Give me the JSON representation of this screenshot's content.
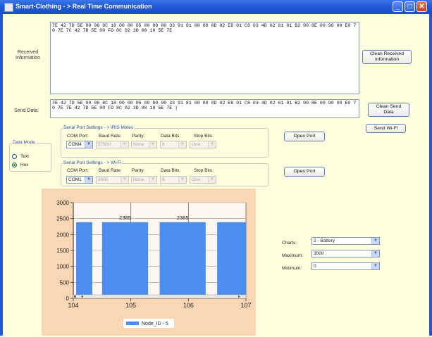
{
  "window": {
    "title": "Smart-Clothing - > Real Time Communication",
    "min_glyph": "_",
    "max_glyph": "□",
    "close_glyph": "✕"
  },
  "received": {
    "label": "Received\nInformation",
    "text": "7E 42 7D 5E 00 08 8C 18 00 00 05 00 00 00 33 91 81 00 00 0D 02 E8 01 C8 03 4D 02 61 01 B2 00 8E 00 90 00 E0 70 7E 7C 42 7D 5E 00 FD 0C 02 3D 00 10 5E 7E",
    "clean_button": "Clean Received\nInformation"
  },
  "send": {
    "label": "Send Data:",
    "text": "7E 42 7D 5E 00 08 8C 18 00 00 05 00 00 00 33 91 81 00 00 0D 02 E8 01 C8 03 4D 02 61 01 B2 00 8E 00 90 00 E0 70 7E 7E 42 7D 5E 00 FD 8C 02 3D 00 10 5E 7E |",
    "clean_button": "Clean Send\nData",
    "wifi_button": "Send Wi-Fi"
  },
  "data_mode": {
    "legend": "Data Mode",
    "options": [
      "Text",
      "Hex"
    ],
    "selected": "Hex"
  },
  "iris": {
    "legend": "Serial Port Settings - > IRIS Motes",
    "headers": [
      "COM Port:",
      "Baud Rate:",
      "Parity:",
      "Data Bits:",
      "Stop Bits:"
    ],
    "values": [
      "COM4",
      "57600",
      "None",
      "8",
      "One"
    ],
    "open_button": "Open Port"
  },
  "wifi": {
    "legend": "Serial Port Settings - > Wi-Fi",
    "headers": [
      "COM Port:",
      "Baud Rate:",
      "Parity:",
      "Data Bits:",
      "Stop Bits:"
    ],
    "values": [
      "COM1",
      "9600",
      "None",
      "8",
      "One"
    ],
    "open_button": "Open Port"
  },
  "chart_settings": {
    "charts_label": "Charts:",
    "charts_value": "2 - Battery",
    "max_label": "Maximum:",
    "max_value": "3000",
    "min_label": "Minimum:",
    "min_value": "0"
  },
  "chart_data": {
    "type": "bar",
    "x": [
      104,
      105,
      106,
      107
    ],
    "xticks": [
      "104",
      "105",
      "106",
      "107"
    ],
    "yticks": [
      "0",
      "500",
      "1000",
      "1500",
      "2000",
      "2500",
      "3000"
    ],
    "ylim": [
      0,
      3000
    ],
    "xlim": [
      104,
      107
    ],
    "bars": [
      {
        "start": 104.05,
        "end": 104.33,
        "value": 2385,
        "label": ""
      },
      {
        "start": 104.5,
        "end": 105.3,
        "value": 2385,
        "label": "2385"
      },
      {
        "start": 105.5,
        "end": 106.3,
        "value": 2385,
        "label": "2385"
      },
      {
        "start": 106.5,
        "end": 107,
        "value": 2385,
        "label": ""
      }
    ],
    "series": [
      {
        "name": "Node_ID - 5",
        "color": "#4b8ef0"
      }
    ],
    "legend_position": "bottom-center",
    "grid": true,
    "bar_color": "#4b8ef0"
  }
}
